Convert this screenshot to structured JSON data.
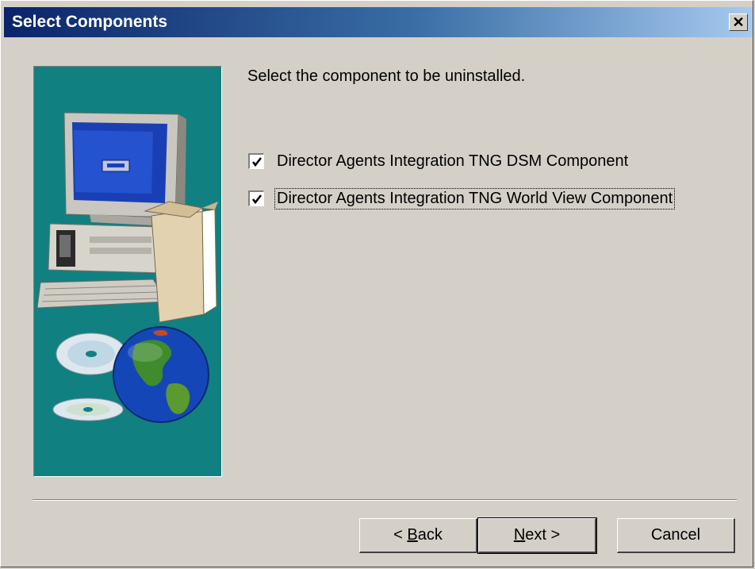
{
  "window": {
    "title": "Select Components",
    "close_glyph": "✕"
  },
  "main": {
    "instruction": "Select the component to be uninstalled.",
    "components": [
      {
        "label": "Director Agents Integration TNG DSM Component",
        "checked": true
      },
      {
        "label": "Director Agents Integration TNG World View Component",
        "checked": true
      }
    ]
  },
  "buttons": {
    "back": {
      "prefix": "< ",
      "accel": "B",
      "rest": "ack"
    },
    "next": {
      "accel": "N",
      "rest": "ext >"
    },
    "cancel": "Cancel"
  },
  "colors": {
    "title_gradient_start": "#0a246a",
    "title_gradient_end": "#a6caf0",
    "panel_teal": "#118080",
    "dialog_face": "#d4d0c8"
  },
  "icons": {
    "art": "computer-box-cd-globe-illustration",
    "check": "checkmark-icon",
    "close": "close-icon"
  }
}
